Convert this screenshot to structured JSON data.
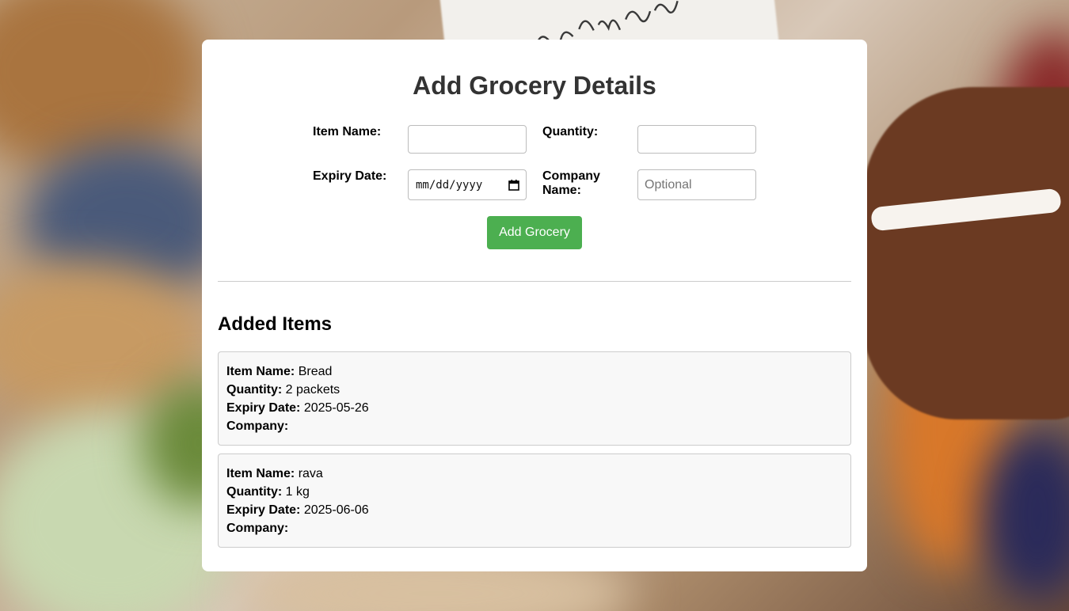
{
  "page": {
    "background_desc_colors": {
      "accent": "#4caf50",
      "card_bg": "#ffffff",
      "item_bg": "#f8f8f8",
      "border": "#cccccc"
    },
    "background_note_text": "potato\nnumbers"
  },
  "form": {
    "title": "Add Grocery Details",
    "item_name_label": "Item Name:",
    "quantity_label": "Quantity:",
    "expiry_date_label": "Expiry Date:",
    "company_name_label_line1": "Company",
    "company_name_label_line2": "Name:",
    "item_name_value": "",
    "quantity_value": "",
    "expiry_date_placeholder": "mm/dd/yyyy",
    "company_name_placeholder": "Optional",
    "submit_label": "Add Grocery"
  },
  "list": {
    "title": "Added Items",
    "field_labels": {
      "item_name": "Item Name:",
      "quantity": "Quantity:",
      "expiry_date": "Expiry Date:",
      "company": "Company:"
    },
    "items": [
      {
        "item_name": "Bread",
        "quantity": "2 packets",
        "expiry_date": "2025-05-26",
        "company": ""
      },
      {
        "item_name": "rava",
        "quantity": "1 kg",
        "expiry_date": "2025-06-06",
        "company": ""
      }
    ]
  }
}
